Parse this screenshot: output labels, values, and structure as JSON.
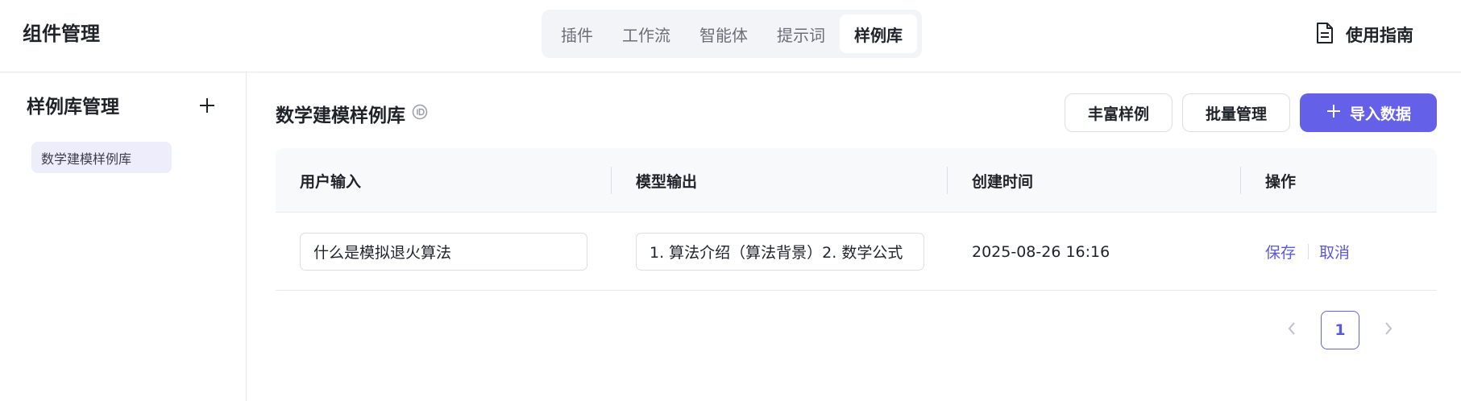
{
  "app": {
    "title": "组件管理"
  },
  "tabs": [
    {
      "label": "插件",
      "active": false
    },
    {
      "label": "工作流",
      "active": false
    },
    {
      "label": "智能体",
      "active": false
    },
    {
      "label": "提示词",
      "active": false
    },
    {
      "label": "样例库",
      "active": true
    }
  ],
  "header": {
    "guide_label": "使用指南",
    "guide_icon": "document-icon"
  },
  "sidebar": {
    "title": "样例库管理",
    "add_icon": "plus-icon",
    "items": [
      {
        "label": "数学建模样例库",
        "selected": true
      }
    ]
  },
  "main": {
    "title": "数学建模样例库",
    "title_icon": "id-icon",
    "buttons": {
      "enrich_label": "丰富样例",
      "batch_label": "批量管理",
      "import_label": "导入数据"
    }
  },
  "table": {
    "columns": [
      {
        "label": "用户输入"
      },
      {
        "label": "模型输出"
      },
      {
        "label": "创建时间"
      },
      {
        "label": "操作"
      }
    ],
    "rows": [
      {
        "user_input": "什么是模拟退火算法",
        "model_output": "1. 算法介绍（算法背景）2. 数学公式",
        "created_at": "2025-08-26 16:16",
        "actions": {
          "save": "保存",
          "cancel": "取消"
        }
      }
    ]
  },
  "pagination": {
    "current_page": "1"
  },
  "colors": {
    "accent": "#6560e8",
    "link": "#5b57e0",
    "selected_bg": "#eeedfb",
    "border": "#dcdee5"
  }
}
